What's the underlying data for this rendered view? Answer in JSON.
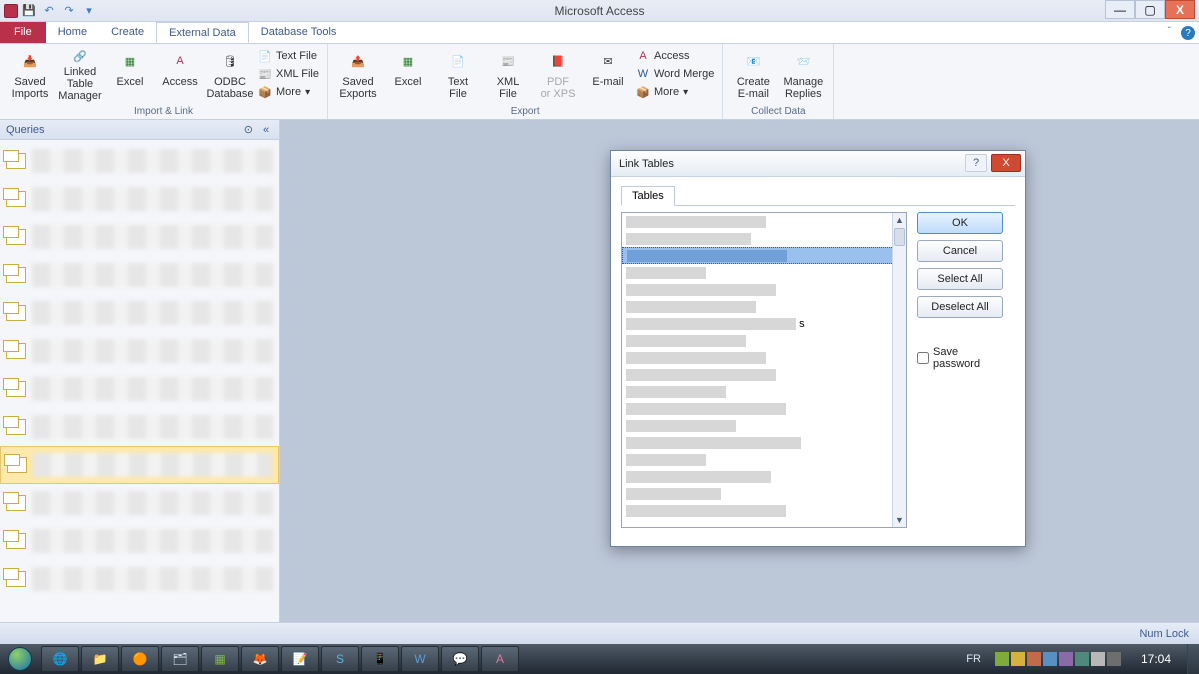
{
  "app_title": "Microsoft Access",
  "window_buttons": {
    "minimize": "—",
    "maximize": "▢",
    "close": "X"
  },
  "tabs": {
    "file": "File",
    "home": "Home",
    "create": "Create",
    "external_data": "External Data",
    "database_tools": "Database Tools"
  },
  "ribbon": {
    "import_link": {
      "label": "Import & Link",
      "saved_imports": "Saved\nImports",
      "linked_table_manager": "Linked Table\nManager",
      "excel": "Excel",
      "access": "Access",
      "odbc": "ODBC\nDatabase",
      "text_file": "Text File",
      "xml_file": "XML File",
      "more": "More"
    },
    "export": {
      "label": "Export",
      "saved_exports": "Saved\nExports",
      "excel": "Excel",
      "text_file": "Text\nFile",
      "xml_file": "XML\nFile",
      "pdf_xps": "PDF\nor XPS",
      "email": "E-mail",
      "access": "Access",
      "word_merge": "Word Merge",
      "more": "More"
    },
    "collect_data": {
      "label": "Collect Data",
      "create_email": "Create\nE-mail",
      "manage_replies": "Manage\nReplies"
    }
  },
  "nav": {
    "title": "Queries"
  },
  "dialog": {
    "title": "Link Tables",
    "tab": "Tables",
    "ok": "OK",
    "cancel": "Cancel",
    "select_all": "Select All",
    "deselect_all": "Deselect All",
    "save_password": "Save password",
    "help": "?",
    "close": "X"
  },
  "statusbar": {
    "numlock": "Num Lock"
  },
  "taskbar": {
    "lang": "FR",
    "clock": "17:04"
  }
}
